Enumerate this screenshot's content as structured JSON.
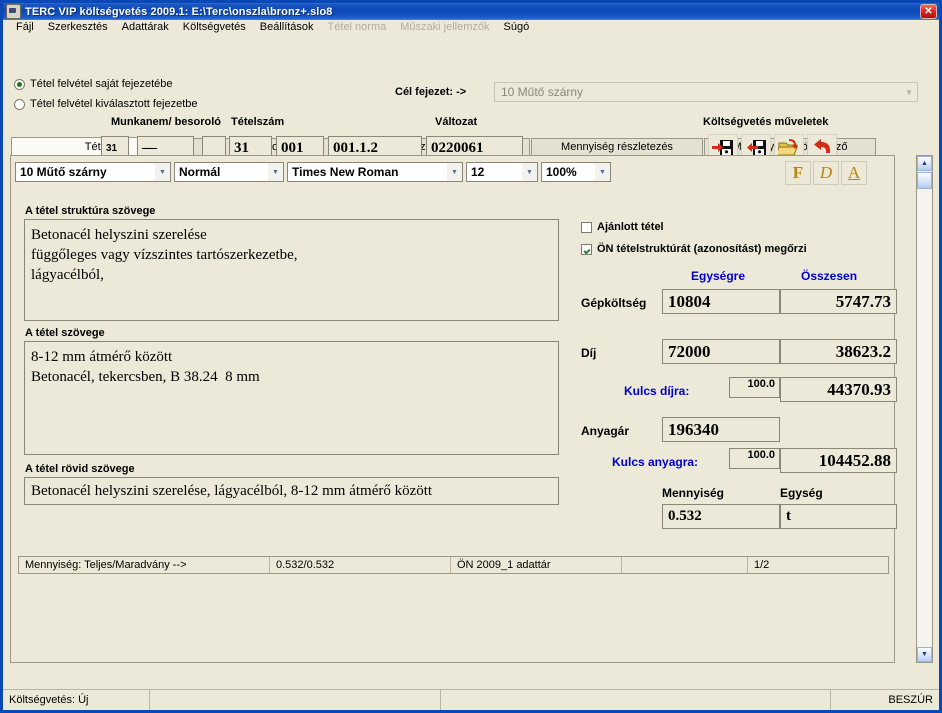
{
  "window": {
    "title": "TERC VIP költségvetés 2009.1:  E:\\Terc\\onszla\\bronz+.slo8",
    "close_label": "✕"
  },
  "menu": {
    "items": [
      {
        "label": "Fájl",
        "disabled": false
      },
      {
        "label": "Szerkesztés",
        "disabled": false
      },
      {
        "label": "Adattárak",
        "disabled": false
      },
      {
        "label": "Költségvetés",
        "disabled": false
      },
      {
        "label": "Beállítások",
        "disabled": false
      },
      {
        "label": "Tétel norma",
        "disabled": true
      },
      {
        "label": "Műszaki jellemzők",
        "disabled": true
      },
      {
        "label": "Súgó",
        "disabled": false
      }
    ]
  },
  "topform": {
    "radio_own": "Tétel felvétel saját fejezetébe",
    "radio_selected": "Tétel felvétel kiválasztott fejezetbe",
    "cel_fejezet_label": "Cél fejezet: ->",
    "cel_fejezet_value": "10 Műtő szárny",
    "labels": {
      "munkanem": "Munkanem/ besoroló",
      "tetelszam": "Tételszám",
      "valtozat": "Változat",
      "muveletek": "Költségvetés műveletek"
    },
    "fields": {
      "f1": "31",
      "f2": "—",
      "f3": "",
      "f4": "31",
      "f5": "001",
      "f6": "001.1.2",
      "f7": "0220061"
    },
    "buttons": [
      {
        "name": "save-right-icon"
      },
      {
        "name": "save-left-icon"
      },
      {
        "name": "open-folder-icon"
      },
      {
        "name": "undo-icon"
      }
    ]
  },
  "tabs": [
    {
      "label": "Tétel",
      "active": true
    },
    {
      "label": "Tétel normák",
      "active": false
    },
    {
      "label": "Műszaki jellemzők",
      "active": false
    },
    {
      "label": "Mennyiség részletezés",
      "active": false
    },
    {
      "label": "Megjegyzés/Könyvjelző",
      "active": false
    }
  ],
  "editor": {
    "chapter": "10 Műtő szárny",
    "style": "Normál",
    "font": "Times New Roman",
    "size": "12",
    "zoom": "100%",
    "bold_label": "F",
    "italic_label": "D",
    "underline_label": "A"
  },
  "sections": {
    "struktura_label": "A tétel struktúra szövege",
    "struktura_text": "Betonacél helyszini szerelése\nfüggőleges vagy vízszintes tartószerkezetbe,\nlágyacélból,",
    "szoveg_label": "A tétel szövege",
    "szoveg_text": "8-12 mm átmérő között\nBetonacél, tekercsben, B 38.24  8 mm",
    "rovid_label": "A tétel rövid szövege",
    "rovid_text": "Betonacél helyszini szerelése, lágyacélból, 8-12 mm átmérő között"
  },
  "right": {
    "ajanlott_label": "Ajánlott tétel",
    "ajanlott_checked": false,
    "on_label": "ÖN tételstruktúrát (azonosítást) megőrzi",
    "on_checked": true,
    "col_unit": "Egységre",
    "col_total": "Összesen",
    "gepkoltseg_label": "Gépköltség",
    "gepkoltseg_unit": "10804",
    "gepkoltseg_total": "5747.73",
    "dij_label": "Díj",
    "dij_unit": "72000",
    "dij_total": "38623.2",
    "kulcs_dijra_label": "Kulcs díjra:",
    "kulcs_dijra_value": "100.0",
    "kulcs_dijra_total": "44370.93",
    "anyagar_label": "Anyagár",
    "anyagar_value": "196340",
    "kulcs_anyagra_label": "Kulcs anyagra:",
    "kulcs_anyagra_value": "100.0",
    "kulcs_anyagra_total": "104452.88",
    "mennyiseg_label": "Mennyiség",
    "egyseg_label": "Egység",
    "mennyiseg_value": "0.532",
    "egyseg_value": "t"
  },
  "panel_status": {
    "c1": "Mennyiség:  Teljes/Maradvány -->",
    "c2": "0.532/0.532",
    "c3": "ÖN 2009_1 adattár",
    "c4": "",
    "c5": "1/2"
  },
  "statusbar": {
    "left": "Költségvetés: Új",
    "mid1": "",
    "mid2": "",
    "right": "BESZÚR"
  },
  "scroll": {
    "up": "▲",
    "down": "▼"
  },
  "colors": {
    "accent_blue": "#0000cd",
    "window_blue": "#0a49b5",
    "face": "#ece9d8",
    "gold": "#b8860b"
  }
}
